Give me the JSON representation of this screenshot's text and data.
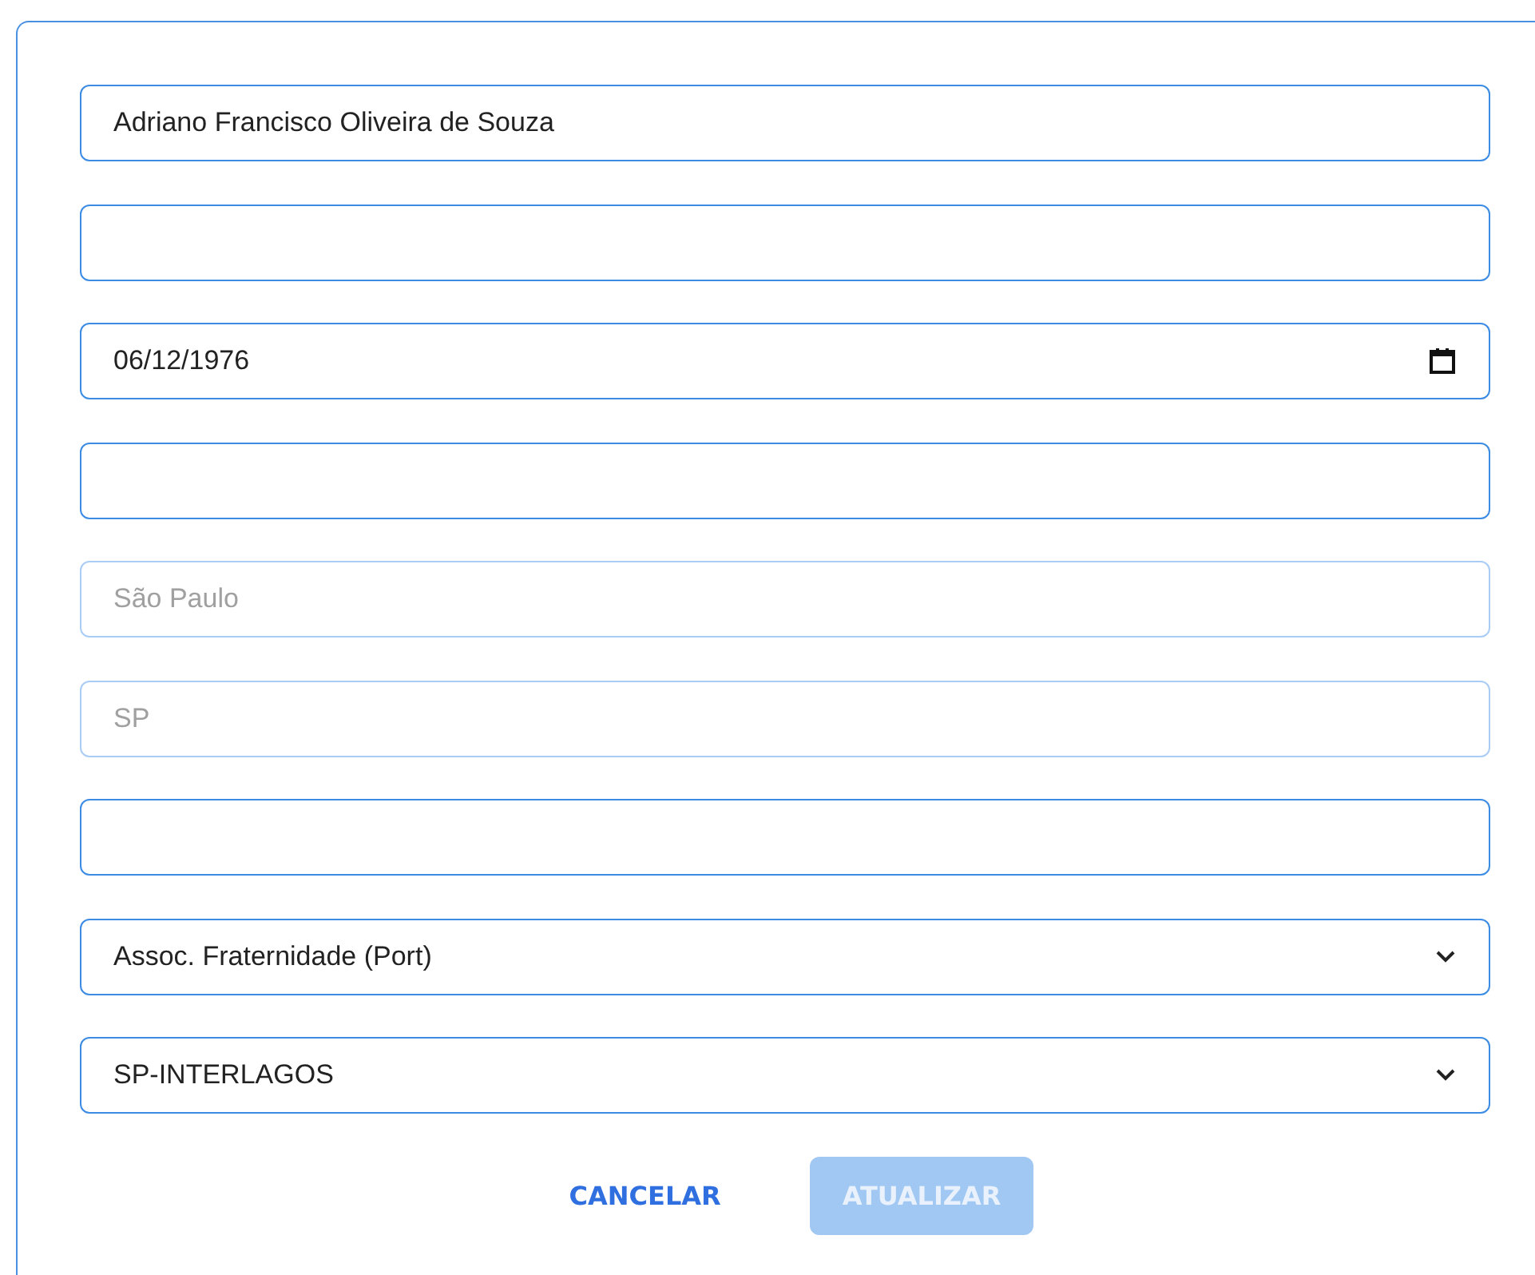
{
  "fields": [
    {
      "kind": "text",
      "value": "Adriano Francisco Oliveira de Souza",
      "disabled": false
    },
    {
      "kind": "text",
      "disabled": false
    },
    {
      "kind": "date",
      "value": "06/12/1976",
      "disabled": false
    },
    {
      "kind": "text",
      "disabled": false
    },
    {
      "kind": "text",
      "value": "São Paulo",
      "disabled": true
    },
    {
      "kind": "text",
      "value": "SP",
      "disabled": true
    },
    {
      "kind": "text",
      "disabled": false
    },
    {
      "kind": "select",
      "value": "Assoc. Fraternidade (Port)",
      "disabled": false
    },
    {
      "kind": "select",
      "value": "SP-INTERLAGOS",
      "disabled": false
    }
  ],
  "buttons": [
    {
      "kind": "text",
      "label": "CANCELAR",
      "disabled": false
    },
    {
      "kind": "filled",
      "label": "ATUALIZAR",
      "disabled": true
    }
  ]
}
